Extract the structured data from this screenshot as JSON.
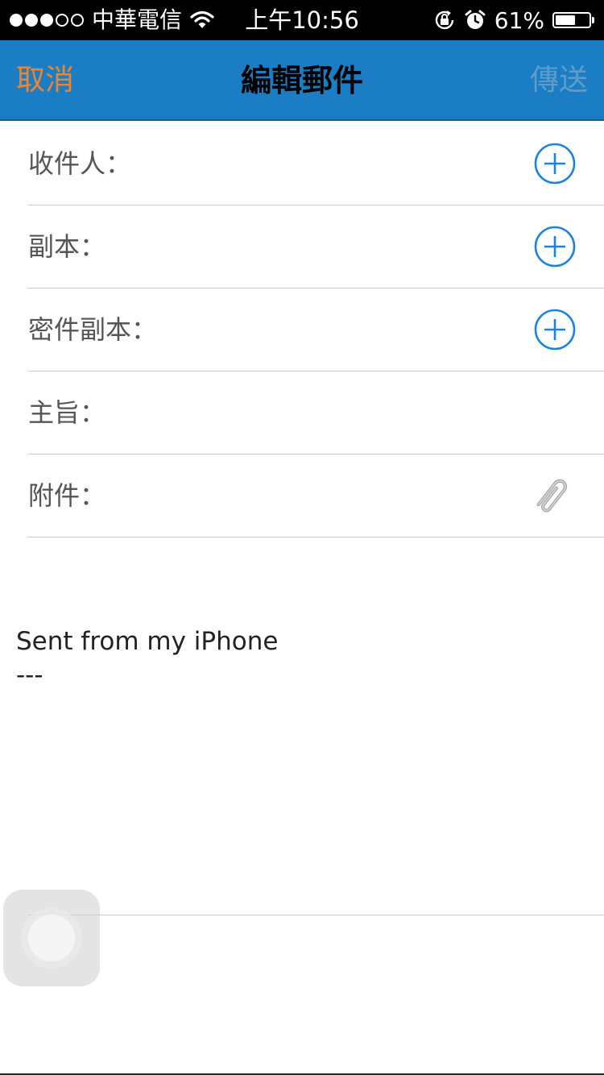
{
  "status_bar": {
    "carrier": "中華電信",
    "signal_bars_filled": 3,
    "signal_bars_total": 5,
    "time": "上午10:56",
    "battery_percent": "61%",
    "battery_level": 0.61
  },
  "nav": {
    "cancel_label": "取消",
    "title": "編輯郵件",
    "send_label": "傳送"
  },
  "fields": {
    "to_label": "收件人：",
    "cc_label": "副本：",
    "bcc_label": "密件副本：",
    "subject_label": "主旨：",
    "attachment_label": "附件："
  },
  "body": {
    "signature": "Sent from my iPhone\n---"
  },
  "colors": {
    "nav_background": "#1b7ec4",
    "cancel_color": "#f2832a",
    "accent_blue": "#1a82e2"
  },
  "icons": {
    "wifi": "wifi-icon",
    "orientation_lock": "orientation-lock-icon",
    "alarm": "alarm-icon",
    "battery": "battery-icon",
    "add": "add-circle-icon",
    "attachment": "paperclip-icon"
  }
}
